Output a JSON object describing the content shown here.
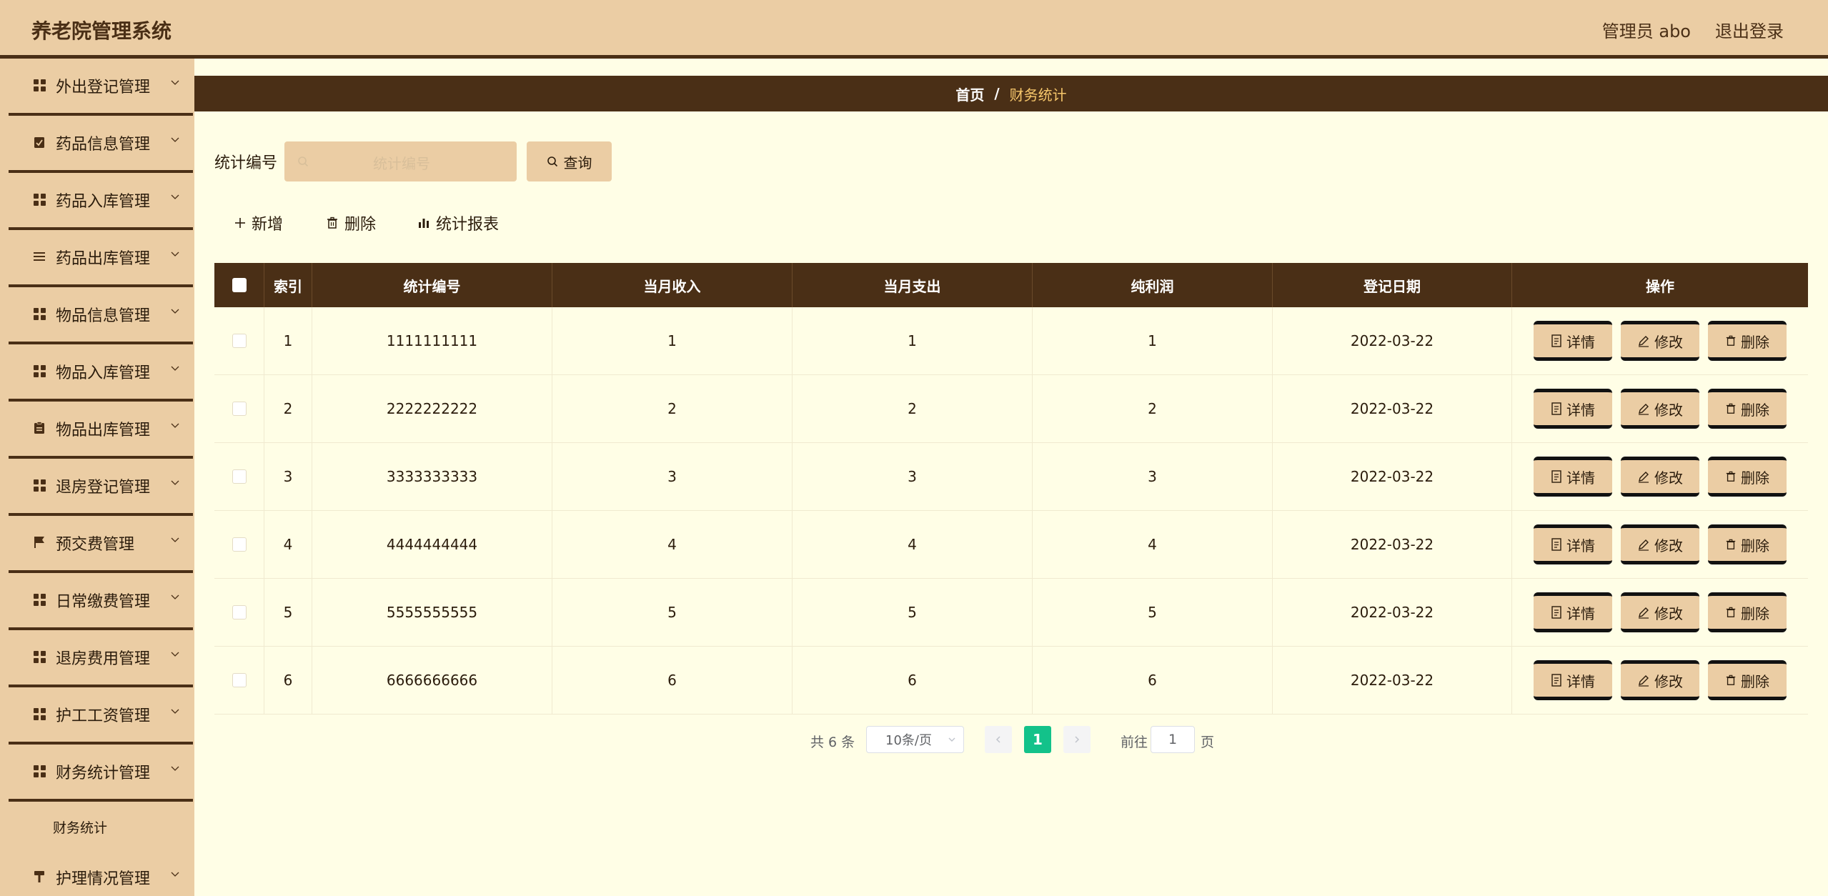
{
  "header": {
    "title": "养老院管理系统",
    "user": "管理员 abo",
    "logout": "退出登录"
  },
  "sidebar": {
    "items": [
      {
        "label": "外出登记管理",
        "icon": "grid-icon"
      },
      {
        "label": "药品信息管理",
        "icon": "clipboard-check-icon"
      },
      {
        "label": "药品入库管理",
        "icon": "grid-icon"
      },
      {
        "label": "药品出库管理",
        "icon": "list-icon"
      },
      {
        "label": "物品信息管理",
        "icon": "grid-icon"
      },
      {
        "label": "物品入库管理",
        "icon": "grid-icon"
      },
      {
        "label": "物品出库管理",
        "icon": "clipboard-icon"
      },
      {
        "label": "退房登记管理",
        "icon": "grid-icon"
      },
      {
        "label": "预交费管理",
        "icon": "flag-icon"
      },
      {
        "label": "日常缴费管理",
        "icon": "grid-icon"
      },
      {
        "label": "退房费用管理",
        "icon": "grid-icon"
      },
      {
        "label": "护工工资管理",
        "icon": "grid-icon"
      },
      {
        "label": "财务统计管理",
        "icon": "grid-icon"
      }
    ],
    "submenu": "财务统计",
    "last_item": {
      "label": "护理情况管理",
      "icon": "hammer-icon"
    }
  },
  "breadcrumb": {
    "home": "首页",
    "separator": "/",
    "current": "财务统计"
  },
  "search": {
    "label": "统计编号",
    "placeholder": "统计编号",
    "button": "查询"
  },
  "toolbar": {
    "add": "新增",
    "delete": "删除",
    "report": "统计报表"
  },
  "table": {
    "columns": [
      "索引",
      "统计编号",
      "当月收入",
      "当月支出",
      "纯利润",
      "登记日期",
      "操作"
    ],
    "rows": [
      {
        "index": "1",
        "no": "1111111111",
        "income": "1",
        "expense": "1",
        "profit": "1",
        "date": "2022-03-22"
      },
      {
        "index": "2",
        "no": "2222222222",
        "income": "2",
        "expense": "2",
        "profit": "2",
        "date": "2022-03-22"
      },
      {
        "index": "3",
        "no": "3333333333",
        "income": "3",
        "expense": "3",
        "profit": "3",
        "date": "2022-03-22"
      },
      {
        "index": "4",
        "no": "4444444444",
        "income": "4",
        "expense": "4",
        "profit": "4",
        "date": "2022-03-22"
      },
      {
        "index": "5",
        "no": "5555555555",
        "income": "5",
        "expense": "5",
        "profit": "5",
        "date": "2022-03-22"
      },
      {
        "index": "6",
        "no": "6666666666",
        "income": "6",
        "expense": "6",
        "profit": "6",
        "date": "2022-03-22"
      }
    ],
    "ops": {
      "detail": "详情",
      "edit": "修改",
      "delete": "删除"
    }
  },
  "pagination": {
    "total": "共 6 条",
    "page_size": "10条/页",
    "current": "1",
    "goto_label": "前往",
    "goto_value": "1",
    "goto_suffix": "页"
  },
  "colors": {
    "header_bg": "#ebcda4",
    "dark_brown": "#4a2f16",
    "page_bg": "#fffee6",
    "accent_green": "#13c28a",
    "breadcrumb_current": "#f7c76b"
  }
}
